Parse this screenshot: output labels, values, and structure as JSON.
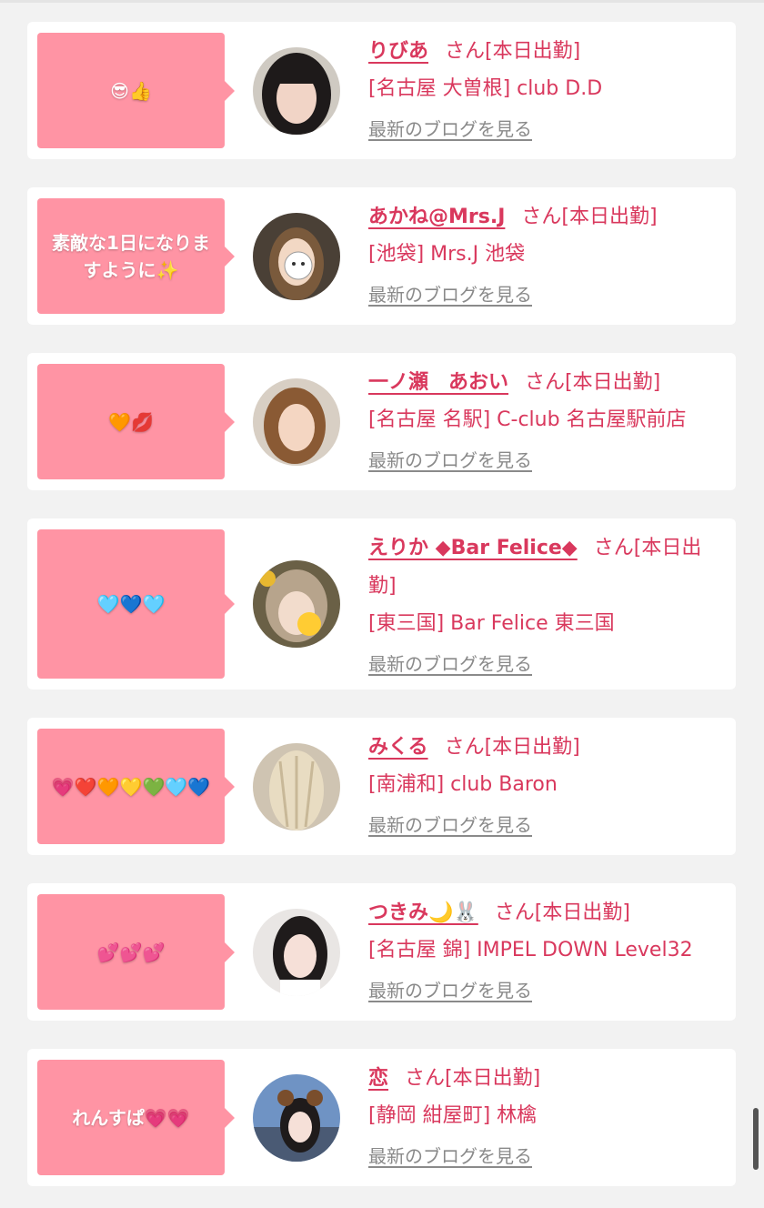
{
  "blog_label": "最新のブログを見る",
  "colors": {
    "bubble": "#ff94a4",
    "accent": "#d9385d",
    "link_gray": "#8a8a8a"
  },
  "entries": [
    {
      "message": "😎👍",
      "name": "りびあ",
      "suffix": "さん[本日出勤]",
      "shop": "[名古屋 大曽根] club D.D",
      "avatar_icon": "avatar-photo"
    },
    {
      "message": "素敵な1日になりますように✨",
      "name": "あかね@Mrs.J",
      "suffix": "さん[本日出勤]",
      "shop": "[池袋] Mrs.J 池袋",
      "avatar_icon": "avatar-photo"
    },
    {
      "message": "🧡💋",
      "name": "一ノ瀬　あおい",
      "suffix": "さん[本日出勤]",
      "shop": "[名古屋 名駅] C-club 名古屋駅前店",
      "avatar_icon": "avatar-photo"
    },
    {
      "message": "🩵💙🩵",
      "name": "えりか ◆Bar Felice◆",
      "suffix": "さん[本日出勤]",
      "shop": "[東三国] Bar Felice 東三国",
      "avatar_icon": "avatar-photo"
    },
    {
      "message": "💗❤️🧡💛💚🩵💙",
      "name": "みくる",
      "suffix": "さん[本日出勤]",
      "shop": "[南浦和] club Baron",
      "avatar_icon": "avatar-photo"
    },
    {
      "message": "💕💕💕",
      "name": "つきみ🌙🐰",
      "suffix": "さん[本日出勤]",
      "shop": "[名古屋 錦] IMPEL DOWN Level32",
      "avatar_icon": "avatar-photo"
    },
    {
      "message": "れんすぱ💗💗",
      "name": "恋",
      "suffix": "さん[本日出勤]",
      "shop": "[静岡 紺屋町] 林檎",
      "avatar_icon": "avatar-photo"
    }
  ]
}
